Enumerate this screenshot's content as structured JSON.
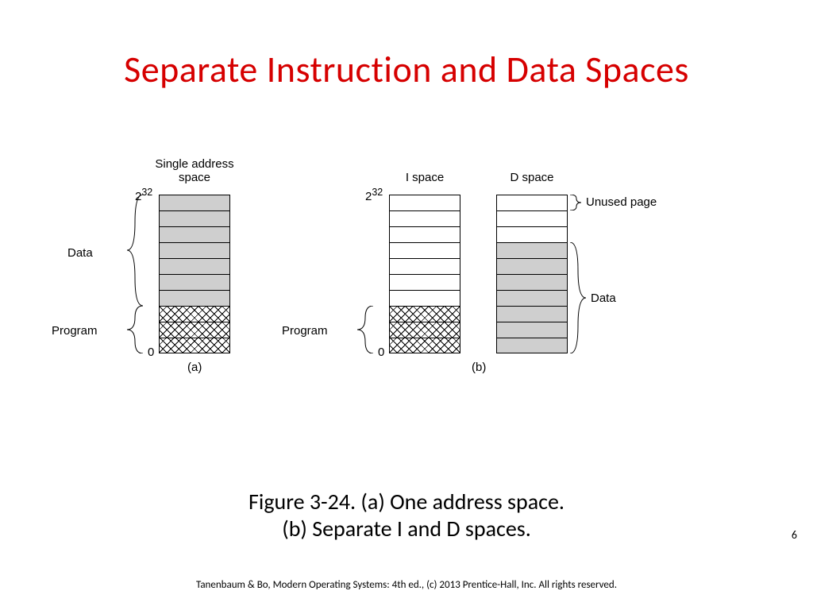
{
  "title": "Separate Instruction and Data Spaces",
  "diagram": {
    "a": {
      "heading_l1": "Single address",
      "heading_l2": "space",
      "top_tick": "2",
      "top_exp": "32",
      "bottom_tick": "0",
      "data_label": "Data",
      "program_label": "Program",
      "sub": "(a)"
    },
    "b": {
      "i_heading": "I space",
      "d_heading": "D space",
      "top_tick": "2",
      "top_exp": "32",
      "bottom_tick": "0",
      "program_label": "Program",
      "unused_label": "Unused page",
      "data_label": "Data",
      "sub": "(b)"
    }
  },
  "caption_l1": "Figure 3-24. (a) One address space.",
  "caption_l2": "(b) Separate I and D spaces.",
  "page_number": "6",
  "footer": "Tanenbaum & Bo, Modern Operating Systems: 4th ed., (c) 2013 Prentice-Hall, Inc. All rights reserved."
}
